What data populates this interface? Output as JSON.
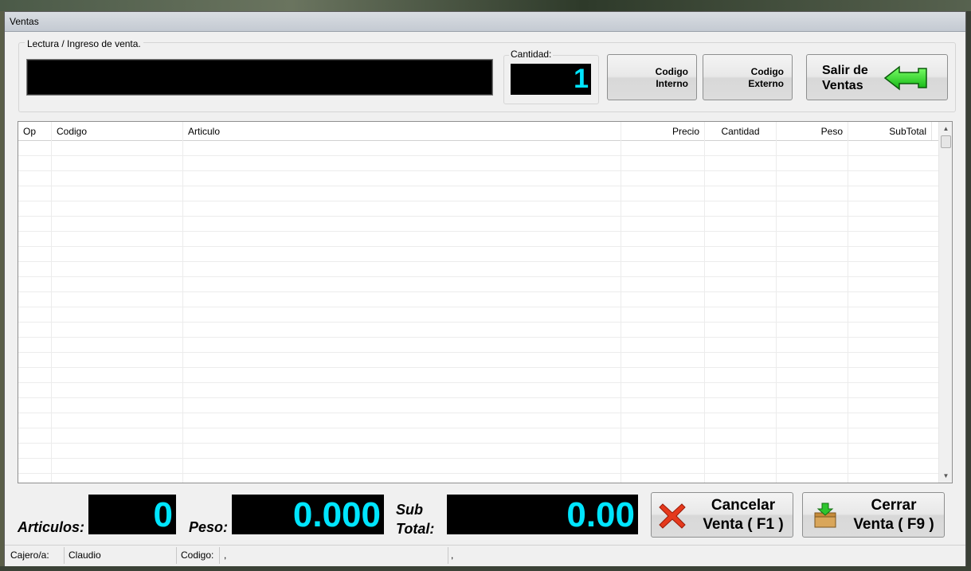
{
  "window": {
    "title": "Ventas"
  },
  "reading": {
    "caption": "Lectura / Ingreso de venta.",
    "value": ""
  },
  "quantity": {
    "caption": "Cantidad:",
    "value": "1"
  },
  "buttons": {
    "codigo_interno": [
      "Codigo",
      "Interno"
    ],
    "codigo_externo": [
      "Codigo",
      "Externo"
    ],
    "salir": [
      "Salir de",
      "Ventas"
    ],
    "cancelar": [
      "Cancelar",
      "Venta ( F1 )"
    ],
    "cerrar": [
      "Cerrar",
      "Venta ( F9 )"
    ]
  },
  "grid": {
    "columns": [
      "Op",
      "Codigo",
      "Articulo",
      "Precio",
      "Cantidad",
      "Peso",
      "SubTotal"
    ],
    "rows": []
  },
  "totals": {
    "articulos_label": "Articulos:",
    "articulos_value": "0",
    "peso_label": "Peso:",
    "peso_value": "0.000",
    "subtotal_label": [
      "Sub",
      "Total:"
    ],
    "subtotal_value": "0.00"
  },
  "status": {
    "cajero_label": "Cajero/a:",
    "cajero_value": "Claudio",
    "codigo_label": "Codigo:",
    "codigo_value": ",",
    "extra_value": ","
  },
  "colors": {
    "display_text": "#00e5ff",
    "display_bg": "#000000",
    "exit_arrow": "#19d419",
    "cancel_x": "#e03a1e"
  },
  "icons": {
    "exit": "left-arrow-icon",
    "cancel": "x-icon",
    "close": "download-box-icon",
    "scroll_up": "chevron-up-icon",
    "scroll_down": "chevron-down-icon"
  }
}
